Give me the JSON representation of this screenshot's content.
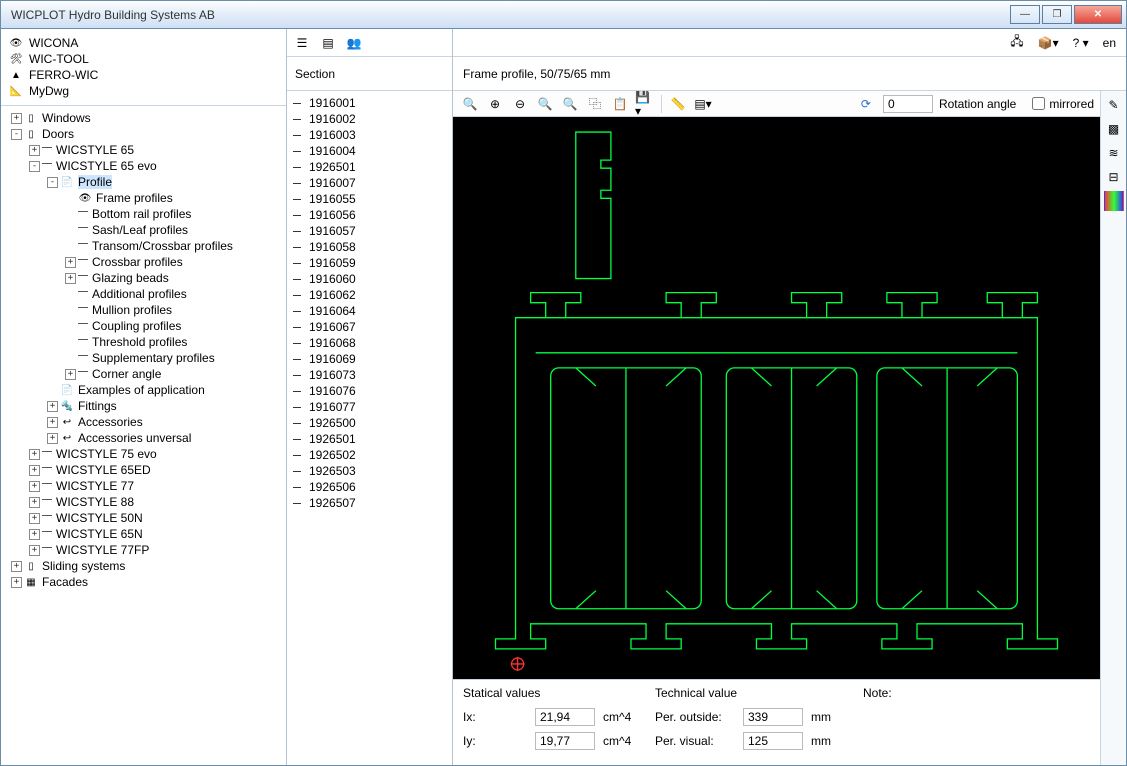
{
  "title": "WICPLOT   Hydro Building Systems AB",
  "topnav": [
    {
      "icon": "👁",
      "label": "WICONA"
    },
    {
      "icon": "🛠",
      "label": "WIC-TOOL"
    },
    {
      "icon": "▲",
      "label": "FERRO-WIC"
    },
    {
      "icon": "📐",
      "label": "MyDwg"
    }
  ],
  "tree": [
    {
      "d": 0,
      "tw": "+",
      "icon": "▯",
      "label": "Windows"
    },
    {
      "d": 0,
      "tw": "-",
      "icon": "▯",
      "label": "Doors"
    },
    {
      "d": 1,
      "tw": "+",
      "dash": true,
      "label": "WICSTYLE 65"
    },
    {
      "d": 1,
      "tw": "-",
      "dash": true,
      "label": "WICSTYLE 65 evo"
    },
    {
      "d": 2,
      "tw": "-",
      "icon": "📄",
      "label": "Profile",
      "sel": true
    },
    {
      "d": 3,
      "tw": "",
      "icon": "👁",
      "label": "Frame profiles"
    },
    {
      "d": 3,
      "tw": "",
      "dash": true,
      "label": "Bottom rail profiles"
    },
    {
      "d": 3,
      "tw": "",
      "dash": true,
      "label": "Sash/Leaf profiles"
    },
    {
      "d": 3,
      "tw": "",
      "dash": true,
      "label": "Transom/Crossbar profiles"
    },
    {
      "d": 3,
      "tw": "+",
      "dash": true,
      "label": "Crossbar profiles"
    },
    {
      "d": 3,
      "tw": "+",
      "dash": true,
      "label": "Glazing beads"
    },
    {
      "d": 3,
      "tw": "",
      "dash": true,
      "label": "Additional profiles"
    },
    {
      "d": 3,
      "tw": "",
      "dash": true,
      "label": "Mullion profiles"
    },
    {
      "d": 3,
      "tw": "",
      "dash": true,
      "label": "Coupling profiles"
    },
    {
      "d": 3,
      "tw": "",
      "dash": true,
      "label": "Threshold profiles"
    },
    {
      "d": 3,
      "tw": "",
      "dash": true,
      "label": "Supplementary profiles"
    },
    {
      "d": 3,
      "tw": "+",
      "dash": true,
      "label": "Corner angle"
    },
    {
      "d": 2,
      "tw": "",
      "icon": "📄",
      "label": "Examples of application"
    },
    {
      "d": 2,
      "tw": "+",
      "icon": "🔩",
      "label": "Fittings"
    },
    {
      "d": 2,
      "tw": "+",
      "icon": "↩",
      "label": "Accessories"
    },
    {
      "d": 2,
      "tw": "+",
      "icon": "↩",
      "label": "Accessories unversal"
    },
    {
      "d": 1,
      "tw": "+",
      "dash": true,
      "label": "WICSTYLE 75 evo"
    },
    {
      "d": 1,
      "tw": "+",
      "dash": true,
      "label": "WICSTYLE 65ED"
    },
    {
      "d": 1,
      "tw": "+",
      "dash": true,
      "label": "WICSTYLE 77"
    },
    {
      "d": 1,
      "tw": "+",
      "dash": true,
      "label": "WICSTYLE 88"
    },
    {
      "d": 1,
      "tw": "+",
      "dash": true,
      "label": "WICSTYLE 50N"
    },
    {
      "d": 1,
      "tw": "+",
      "dash": true,
      "label": "WICSTYLE 65N"
    },
    {
      "d": 1,
      "tw": "+",
      "dash": true,
      "label": "WICSTYLE 77FP"
    },
    {
      "d": 0,
      "tw": "+",
      "icon": "▯",
      "label": "Sliding systems"
    },
    {
      "d": 0,
      "tw": "+",
      "icon": "▦",
      "label": "Facades"
    }
  ],
  "section_header": "Section",
  "sections": [
    "1916001",
    "1916002",
    "1916003",
    "1916004",
    "1926501",
    "1916007",
    "1916055",
    "1916056",
    "1916057",
    "1916058",
    "1916059",
    "1916060",
    "1916062",
    "1916064",
    "1916067",
    "1916068",
    "1916069",
    "1916073",
    "1916076",
    "1916077",
    "1926500",
    "1926501",
    "1926502",
    "1926503",
    "1926506",
    "1926507"
  ],
  "profile_name": "Frame profile, 50/75/65 mm",
  "rotation": {
    "value": "0",
    "label": "Rotation angle"
  },
  "mirrored_label": "mirrored",
  "help_lang": "en",
  "bottom": {
    "statical_title": "Statical values",
    "technical_title": "Technical value",
    "note_title": "Note:",
    "ix_label": "Ix:",
    "ix_value": "21,94",
    "ix_unit": "cm^4",
    "iy_label": "Iy:",
    "iy_value": "19,77",
    "iy_unit": "cm^4",
    "per_out_label": "Per. outside:",
    "per_out_value": "339",
    "mm": "mm",
    "per_vis_label": "Per. visual:",
    "per_vis_value": "125"
  }
}
